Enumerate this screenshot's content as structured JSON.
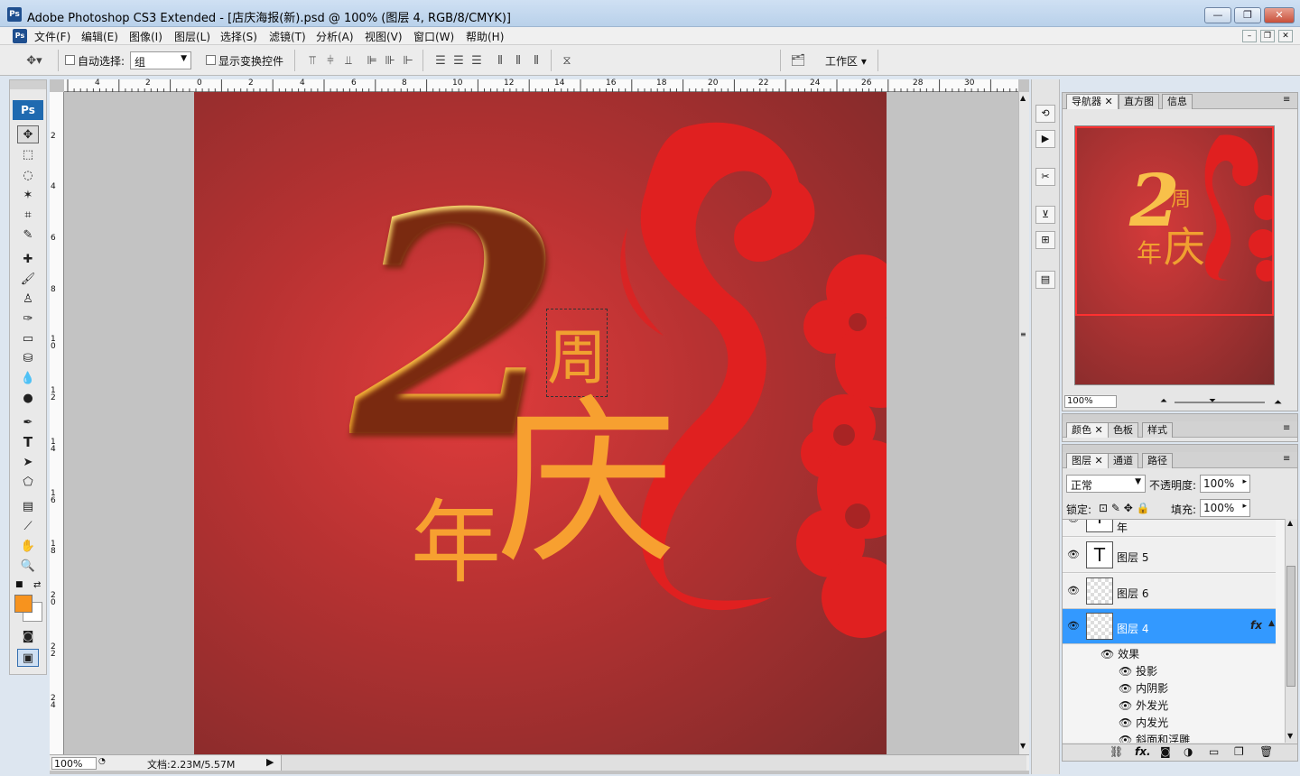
{
  "window": {
    "title": "Adobe Photoshop CS3 Extended - [店庆海报(新).psd @ 100% (图层 4, RGB/8/CMYK)]",
    "app_icon": "Ps",
    "min": "—",
    "max": "❐",
    "close": "✕"
  },
  "menu": [
    "文件(F)",
    "编辑(E)",
    "图像(I)",
    "图层(L)",
    "选择(S)",
    "滤镜(T)",
    "分析(A)",
    "视图(V)",
    "窗口(W)",
    "帮助(H)"
  ],
  "options": {
    "auto_select_label": "自动选择:",
    "auto_select_value": "组",
    "show_transform_label": "显示变换控件",
    "workspace_label": "工作区"
  },
  "rulers": {
    "top_ticks": [
      "4",
      "2",
      "0",
      "2",
      "4",
      "6",
      "8",
      "10",
      "12",
      "14",
      "16",
      "18",
      "20",
      "22",
      "24",
      "26",
      "28",
      "30"
    ],
    "left_ticks": [
      "2",
      "4",
      "6",
      "8",
      "10",
      "12",
      "14",
      "16",
      "18",
      "20",
      "22",
      "24"
    ]
  },
  "canvas_text": {
    "big_two": "2",
    "zhou": "周",
    "nian": "年",
    "qing": "庆"
  },
  "status": {
    "zoom": "100%",
    "doc": "文档:2.23M/5.57M"
  },
  "navigator": {
    "tabs": [
      "导航器",
      "直方图",
      "信息"
    ],
    "zoom": "100%"
  },
  "color_panel": {
    "tabs": [
      "颜色",
      "色板",
      "样式"
    ]
  },
  "layers_panel": {
    "tabs": [
      "图层",
      "通道",
      "路径"
    ],
    "blend_mode": "正常",
    "opacity_label": "不透明度:",
    "opacity": "100%",
    "lock_label": "锁定:",
    "fill_label": "填充:",
    "fill": "100%",
    "partial_layer": "年",
    "layers": [
      {
        "name": "图层 5",
        "type": "text",
        "thumb": "T"
      },
      {
        "name": "图层 6",
        "type": "pixel"
      },
      {
        "name": "图层 4",
        "type": "pixel",
        "selected": true,
        "fx": "fx"
      }
    ],
    "effects_label": "效果",
    "effects": [
      "投影",
      "内阴影",
      "外发光",
      "内发光",
      "斜面和浮雕"
    ]
  },
  "colors": {
    "foreground": "#f7931e",
    "background": "#ffffff",
    "selection": "#3399ff"
  }
}
